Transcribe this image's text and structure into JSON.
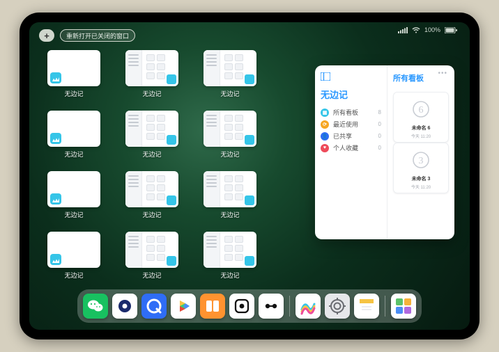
{
  "status": {
    "battery_pct": "100%"
  },
  "topbar": {
    "plus_label": "+",
    "reopen_label": "重新打开已关闭的窗口"
  },
  "app_name": "无边记",
  "thumbs": [
    {
      "type": "blank",
      "label": "无边记"
    },
    {
      "type": "sidebar",
      "label": "无边记"
    },
    {
      "type": "sidebar",
      "label": "无边记"
    },
    {
      "type": "blank",
      "label": "无边记"
    },
    {
      "type": "sidebar",
      "label": "无边记"
    },
    {
      "type": "sidebar",
      "label": "无边记"
    },
    {
      "type": "blank",
      "label": "无边记"
    },
    {
      "type": "sidebar",
      "label": "无边记"
    },
    {
      "type": "sidebar",
      "label": "无边记"
    },
    {
      "type": "blank",
      "label": "无边记"
    },
    {
      "type": "sidebar",
      "label": "无边记"
    },
    {
      "type": "sidebar",
      "label": "无边记"
    }
  ],
  "panel": {
    "sidebar_title": "无边记",
    "items": [
      {
        "icon": "all",
        "color": "#35c5e8",
        "label": "所有看板",
        "count": 8
      },
      {
        "icon": "recent",
        "color": "#f6a623",
        "label": "最近使用",
        "count": 0
      },
      {
        "icon": "shared",
        "color": "#2f6df6",
        "label": "已共享",
        "count": 0
      },
      {
        "icon": "favorite",
        "color": "#ee4b5a",
        "label": "个人收藏",
        "count": 0
      }
    ],
    "boards_title": "所有看板",
    "boards": [
      {
        "digit": "6",
        "name": "未命名 6",
        "time": "今天 11:20"
      },
      {
        "digit": "3",
        "name": "未命名 3",
        "time": "今天 11:20"
      }
    ]
  },
  "dock": {
    "apps": [
      {
        "name": "wechat",
        "bg": "#18c160"
      },
      {
        "name": "quark",
        "bg": "#ffffff"
      },
      {
        "name": "circle-q",
        "bg": "#2f6df6"
      },
      {
        "name": "play",
        "bg": "#ffffff"
      },
      {
        "name": "books",
        "bg": "#ff9330"
      },
      {
        "name": "dice",
        "bg": "#ffffff"
      },
      {
        "name": "connect",
        "bg": "#ffffff"
      },
      {
        "name": "freeform",
        "bg": "#ffffff"
      },
      {
        "name": "settings",
        "bg": "#e6e7ea"
      },
      {
        "name": "notes",
        "bg": "#ffffff"
      },
      {
        "name": "folder",
        "bg": "#ffffff"
      }
    ]
  }
}
